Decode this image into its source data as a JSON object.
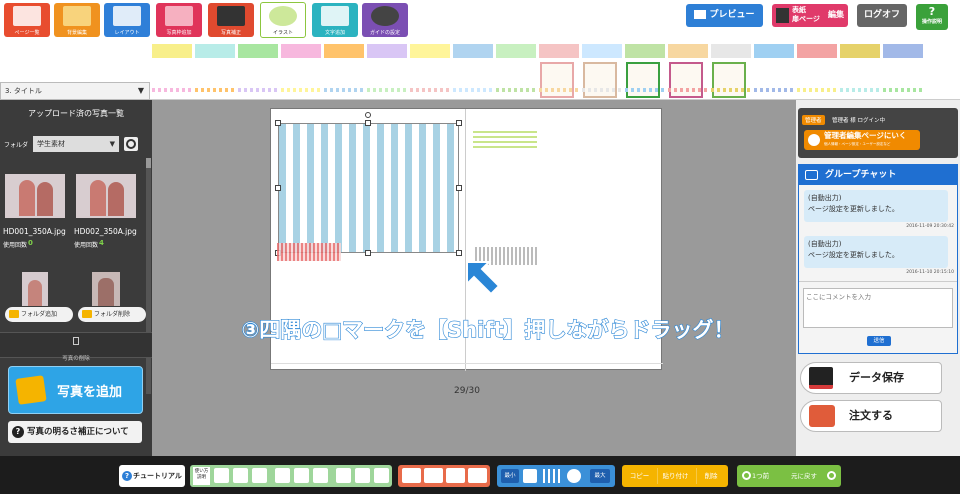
{
  "toolbar": {
    "tabs": [
      {
        "label": "ページ一覧",
        "color": "#e84d2f"
      },
      {
        "label": "背景編集",
        "color": "#f0921f"
      },
      {
        "label": "レイアウト",
        "color": "#2f7fd8"
      },
      {
        "label": "写真枠追加",
        "color": "#e0345a"
      },
      {
        "label": "写真補正",
        "color": "#e04a2f"
      },
      {
        "label": "イラスト",
        "color": "#8cc63f"
      },
      {
        "label": "文字追加",
        "color": "#2bb3c0"
      },
      {
        "label": "ガイドの設定",
        "color": "#7b4fb3"
      }
    ],
    "preview": "プレビュー",
    "cover_edit_line1": "表紙",
    "cover_edit_line2": "扉ページ",
    "cover_edit_suffix": "編集",
    "logout": "ログオフ",
    "help": "操作説明"
  },
  "strip": {
    "category": "3. タイトル"
  },
  "left": {
    "title": "アップロード済の写真一覧",
    "folder_label": "フォルダ",
    "folder_value": "学生素材",
    "photos": [
      {
        "name": "HD001_350A.jpg",
        "usage_label": "使用回数",
        "count": "0"
      },
      {
        "name": "HD002_350A.jpg",
        "usage_label": "使用回数",
        "count": "4"
      }
    ],
    "add_folder": "フォルダ追加",
    "delete_folder": "フォルダ削除",
    "delete_photo": "写真の削除",
    "add_photo": "写真を追加",
    "brightness": "写真の明るさ補正について"
  },
  "main": {
    "instruction": "③四隅の□マークを【Shift】押しながらドラッグ！",
    "page_number": "29/30"
  },
  "right": {
    "admin_badge": "管理者",
    "admin_status": "管理者 様 ログイン中",
    "admin_button": "管理者編集ページにいく",
    "admin_button_sub": "個人情報・ページ設定・ユーザー設定など",
    "chat_title": "グループチャット",
    "messages": [
      {
        "line1": "(自動出力)",
        "line2": "ページ設定を更新しました。",
        "time": "2016-11-09 20:30:42"
      },
      {
        "line1": "(自動出力)",
        "line2": "ページ設定を更新しました。",
        "time": "2016-11-10 20:15:10"
      }
    ],
    "comment_placeholder": "ここにコメントを入力",
    "send": "送信",
    "save": "データ保存",
    "order": "注文する"
  },
  "bottom": {
    "tutorial": "チュートリアル",
    "howto": "使い方説明",
    "zoom_min": "最小",
    "zoom_max": "最大",
    "copy": "コピー",
    "paste": "貼り付け",
    "delete": "削除",
    "undo": "1つ前",
    "redo": "元に戻す"
  },
  "colors": {
    "left_panel": "#3b3b3b",
    "chat_header": "#1f6fd1",
    "accent_orange": "#f5a623",
    "instruction_text": "#ffffff",
    "instruction_outline": "#2a86d6"
  }
}
